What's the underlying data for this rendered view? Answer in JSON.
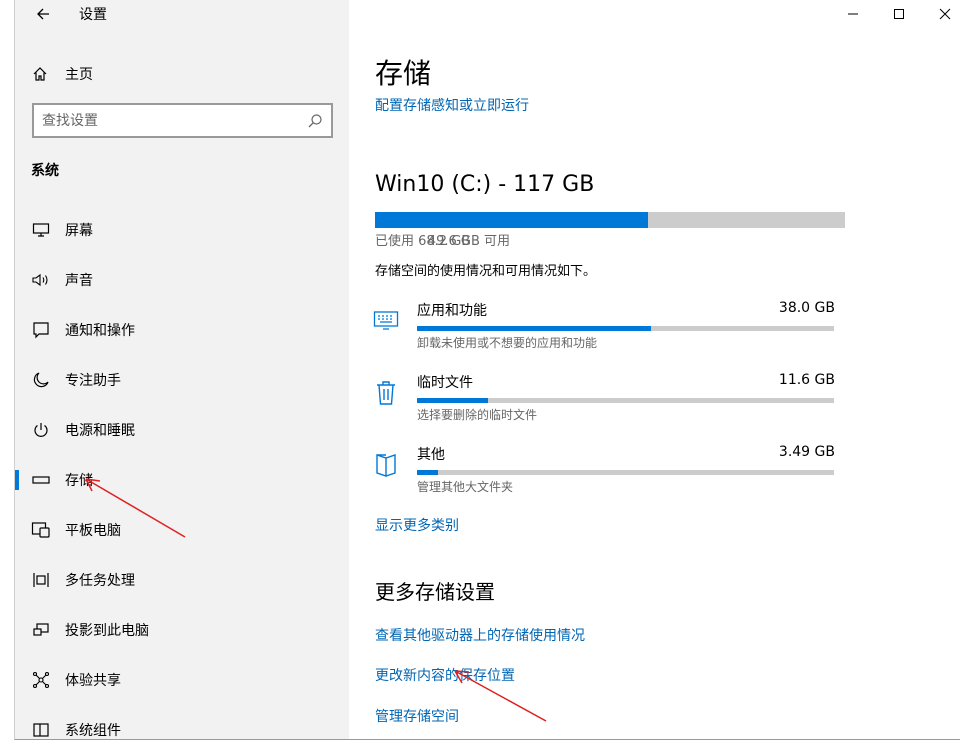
{
  "window": {
    "title": "设置",
    "controls": {
      "minimize": "minimize-icon",
      "maximize": "maximize-icon",
      "close": "close-icon"
    }
  },
  "sidebar": {
    "home_label": "主页",
    "search_placeholder": "查找设置",
    "section": "系统",
    "items": [
      {
        "label": "屏幕",
        "icon": "display-icon",
        "selected": false
      },
      {
        "label": "声音",
        "icon": "speaker-icon",
        "selected": false
      },
      {
        "label": "通知和操作",
        "icon": "notification-icon",
        "selected": false
      },
      {
        "label": "专注助手",
        "icon": "moon-icon",
        "selected": false
      },
      {
        "label": "电源和睡眠",
        "icon": "power-icon",
        "selected": false
      },
      {
        "label": "存储",
        "icon": "storage-icon",
        "selected": true
      },
      {
        "label": "平板电脑",
        "icon": "tablet-icon",
        "selected": false
      },
      {
        "label": "多任务处理",
        "icon": "multitask-icon",
        "selected": false
      },
      {
        "label": "投影到此电脑",
        "icon": "project-icon",
        "selected": false
      },
      {
        "label": "体验共享",
        "icon": "share-icon",
        "selected": false
      },
      {
        "label": "系统组件",
        "icon": "components-icon",
        "selected": false
      }
    ]
  },
  "main": {
    "title": "存储",
    "configure_link": "配置存储感知或立即运行",
    "drive": {
      "title": "Win10 (C:) - 117 GB",
      "used_fraction": 0.58,
      "used_label": "已使用 68.2 GB",
      "free_label": "49.6 GB 可用"
    },
    "description": "存储空间的使用情况和可用情况如下。",
    "categories": [
      {
        "name": "应用和功能",
        "size": "38.0 GB",
        "fraction": 0.56,
        "sub": "卸载未使用或不想要的应用和功能",
        "icon": "apps-icon"
      },
      {
        "name": "临时文件",
        "size": "11.6 GB",
        "fraction": 0.17,
        "sub": "选择要删除的临时文件",
        "icon": "trash-icon"
      },
      {
        "name": "其他",
        "size": "3.49 GB",
        "fraction": 0.05,
        "sub": "管理其他大文件夹",
        "icon": "folder-icon"
      }
    ],
    "show_more": "显示更多类别",
    "more_title": "更多存储设置",
    "more_links": [
      "查看其他驱动器上的存储使用情况",
      "更改新内容的保存位置",
      "管理存储空间"
    ]
  },
  "colors": {
    "accent": "#0078d7",
    "link": "#0066b4",
    "annotation": "#e02020"
  }
}
